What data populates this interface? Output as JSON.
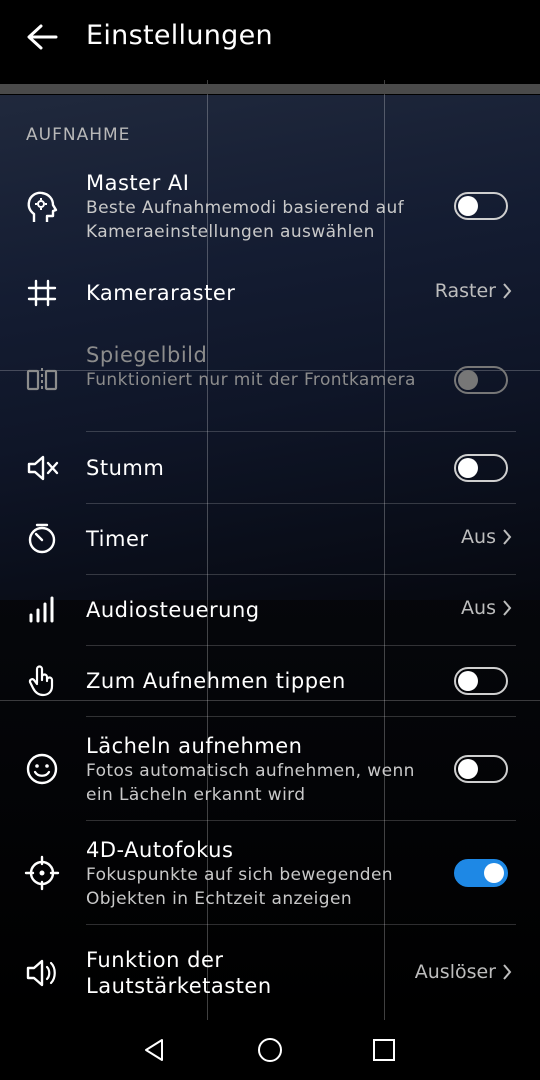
{
  "header": {
    "title": "Einstellungen",
    "back_icon": "arrow-left-icon"
  },
  "section": {
    "label": "AUFNAHME"
  },
  "settings": [
    {
      "icon": "master-ai-head-icon",
      "title": "Master AI",
      "subtitle": "Beste Aufnahmemodi basierend auf Kameraeinstellungen auswählen",
      "control": "toggle",
      "state": "off"
    },
    {
      "icon": "grid-hash-icon",
      "title": "Kameraraster",
      "control": "value",
      "value": "Raster"
    },
    {
      "icon": "mirror-icon",
      "title": "Spiegelbild",
      "subtitle": "Funktioniert nur mit der Frontkamera",
      "control": "toggle",
      "state": "off",
      "disabled": true
    },
    {
      "icon": "mute-speaker-icon",
      "title": "Stumm",
      "control": "toggle",
      "state": "off"
    },
    {
      "icon": "timer-icon",
      "title": "Timer",
      "control": "value",
      "value": "Aus"
    },
    {
      "icon": "audio-bars-icon",
      "title": "Audiosteuerung",
      "control": "value",
      "value": "Aus"
    },
    {
      "icon": "touch-hand-icon",
      "title": "Zum Aufnehmen tippen",
      "control": "toggle",
      "state": "off"
    },
    {
      "icon": "smile-icon",
      "title": "Lächeln aufnehmen",
      "subtitle": "Fotos automatisch aufnehmen, wenn ein Lächeln erkannt wird",
      "control": "toggle",
      "state": "off"
    },
    {
      "icon": "crosshair-icon",
      "title": "4D-Autofokus",
      "subtitle": "Fokuspunkte auf sich bewegenden Objekten in Echtzeit anzeigen",
      "control": "toggle",
      "state": "on"
    },
    {
      "icon": "volume-icon",
      "title": "Funktion der Lautstärketasten",
      "control": "value",
      "value": "Auslöser"
    }
  ],
  "colors": {
    "accent": "#1e88e5",
    "background": "#000000",
    "subtitle": "#c9c9c9"
  },
  "navbar": {
    "back": "nav-back-icon",
    "home": "nav-home-icon",
    "recents": "nav-recents-icon"
  }
}
